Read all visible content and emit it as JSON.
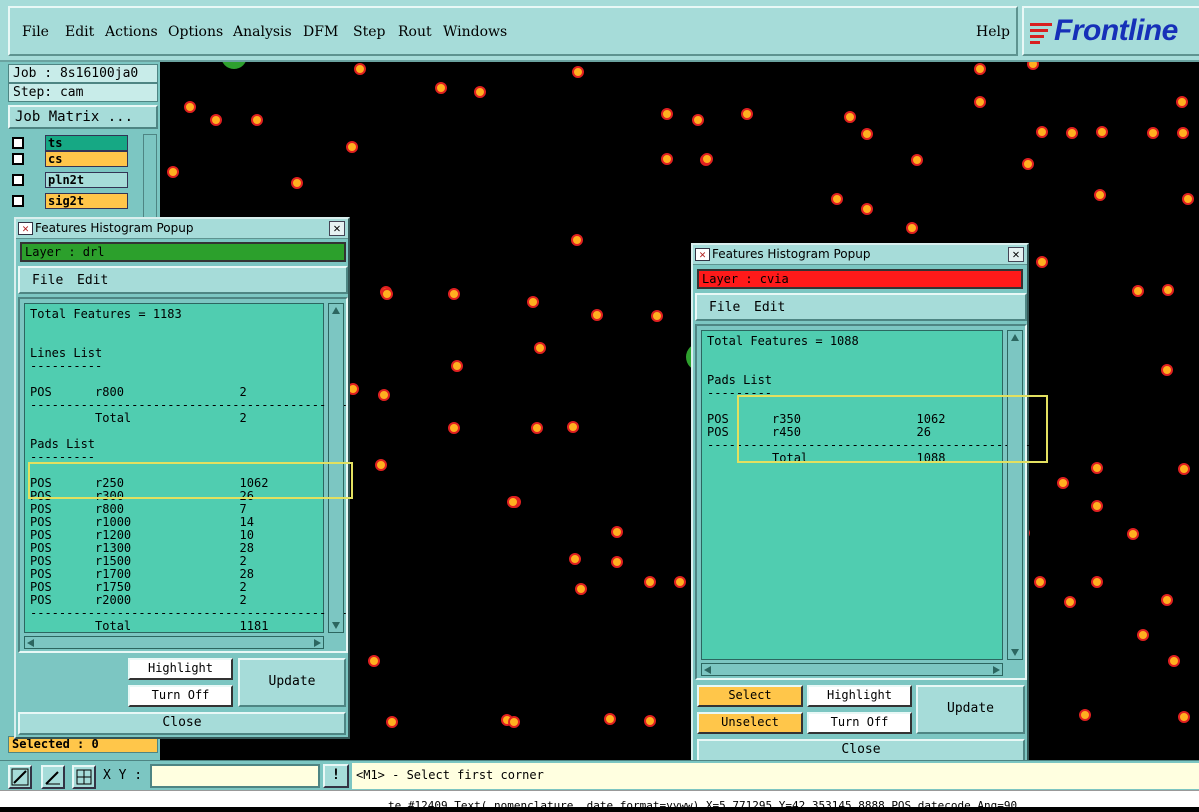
{
  "menubar": {
    "items": [
      "File",
      "Edit",
      "Actions",
      "Options",
      "Analysis",
      "DFM",
      "Step",
      "Rout",
      "Windows"
    ],
    "help": "Help",
    "logo": "Frontline"
  },
  "left_panel": {
    "job": "Job : 8s16100ja0",
    "step": "Step: cam",
    "job_matrix": "Job Matrix ...",
    "layers": [
      {
        "name": "ts",
        "color": "#16a884"
      },
      {
        "name": "cs",
        "color": "#ffc64a"
      },
      {
        "name": "pln2t",
        "color": "#a6dcd9"
      },
      {
        "name": "sig2t",
        "color": "#ffc64a"
      }
    ],
    "selected": "Selected : 0"
  },
  "popup_left": {
    "title": "Features Histogram Popup",
    "close": "✕",
    "layer_label": "Layer :  drl",
    "layer_color": "#2ca02c",
    "menu": [
      "File",
      "Edit"
    ],
    "lines": [
      "Total Features = 1183",
      "",
      "",
      "Lines List",
      "----------",
      "",
      "POS      r800                2",
      "---------------------------------------------",
      "         Total               2",
      "",
      "Pads List",
      "---------",
      "",
      "POS      r250                1062",
      "POS      r300                26",
      "POS      r800                7",
      "POS      r1000               14",
      "POS      r1200               10",
      "POS      r1300               28",
      "POS      r1500               2",
      "POS      r1700               28",
      "POS      r1750               2",
      "POS      r2000               2",
      "---------------------------------------------",
      "         Total               1181"
    ],
    "buttons": {
      "highlight": "Highlight",
      "turn_off": "Turn Off",
      "update": "Update",
      "close": "Close"
    }
  },
  "popup_right": {
    "title": "Features Histogram Popup",
    "close": "✕",
    "layer_label": "Layer :  cvia",
    "layer_color": "#ff1a1a",
    "menu": [
      "File",
      "Edit"
    ],
    "lines": [
      "Total Features = 1088",
      "",
      "",
      "Pads List",
      "---------",
      "",
      "POS      r350                1062",
      "POS      r450                26",
      "---------------------------------------------",
      "         Total               1088"
    ],
    "buttons": {
      "select": "Select",
      "unselect": "Unselect",
      "highlight": "Highlight",
      "turn_off": "Turn Off",
      "update": "Update",
      "close": "Close"
    }
  },
  "command_bar": {
    "xy_label": "X Y :",
    "xy_value": "",
    "excl": "!",
    "prompt": "<M1> - Select first corner"
  },
  "status_bar": {
    "text": "te #12409 Text( nomenclature, date_format=yyww) X=5.771295 Y=42.353145 8888 POS datecode Ang=90"
  },
  "colors": {
    "pad_fill": "#ffb020",
    "pad_edge": "#e02020",
    "green_pad": "#2ea02e"
  }
}
